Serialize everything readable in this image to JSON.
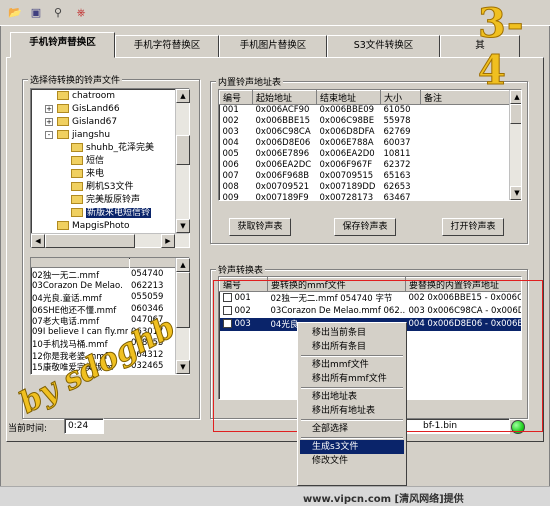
{
  "toolbar": {
    "icons": [
      "open-folder-icon",
      "save-disk-icon",
      "search-tool-icon",
      "exit-icon"
    ]
  },
  "watermark_top": "3-4",
  "tabs": [
    {
      "label": "手机铃声替换区",
      "active": true
    },
    {
      "label": "手机字符替换区",
      "active": false
    },
    {
      "label": "手机图片替换区",
      "active": false
    },
    {
      "label": "S3文件转换区",
      "active": false
    },
    {
      "label": "其",
      "active": false
    }
  ],
  "left": {
    "group_label": "选择待转换的铃声文件",
    "tree": [
      {
        "label": "chatroom",
        "indent": 0,
        "pm": ""
      },
      {
        "label": "GisLand66",
        "indent": 0,
        "pm": "+"
      },
      {
        "label": "Gisland67",
        "indent": 0,
        "pm": "+"
      },
      {
        "label": "jiangshu",
        "indent": 0,
        "pm": "-"
      },
      {
        "label": "shuhb_花泽完美",
        "indent": 1,
        "pm": ""
      },
      {
        "label": "短信",
        "indent": 1,
        "pm": ""
      },
      {
        "label": "来电",
        "indent": 1,
        "pm": ""
      },
      {
        "label": "刷机S3文件",
        "indent": 1,
        "pm": ""
      },
      {
        "label": "完美版原铃声",
        "indent": 1,
        "pm": ""
      },
      {
        "label": "新版来电短信铃",
        "indent": 1,
        "pm": "",
        "selected": true
      },
      {
        "label": "MapgisPhoto",
        "indent": 0,
        "pm": ""
      }
    ],
    "files": [
      [
        "02独一无二.mmf",
        "054740"
      ],
      [
        "03Corazon De Melao.",
        "062213"
      ],
      [
        "04光良.童话.mmf",
        "055059"
      ],
      [
        "06SHE他还不懂.mmf",
        "060346"
      ],
      [
        "07老大电话.mmf",
        "047067"
      ],
      [
        "09I believe I can fly.mmf",
        "063017"
      ],
      [
        "10手机找马桶.mmf",
        "058255"
      ],
      [
        "12你是我老婆.mmf",
        "064312"
      ],
      [
        "15康敬唯爱完美版.m",
        "032465"
      ]
    ]
  },
  "builtin": {
    "group_label": "内置铃声地址表",
    "columns": [
      "编号",
      "起始地址",
      "结束地址",
      "大小",
      "备注"
    ],
    "rows": [
      [
        "001",
        "0x006ACF90",
        "0x006BBE09",
        "61050"
      ],
      [
        "002",
        "0x006BBE15",
        "0x006C98BE",
        "55978"
      ],
      [
        "003",
        "0x006C98CA",
        "0x006D8DFA",
        "62769"
      ],
      [
        "004",
        "0x006D8E06",
        "0x006E788A",
        "60037"
      ],
      [
        "005",
        "0x006E7896",
        "0x006EA2D0",
        "10811"
      ],
      [
        "006",
        "0x006EA2DC",
        "0x006F967F",
        "62372"
      ],
      [
        "007",
        "0x006F968B",
        "0x00709515",
        "65163"
      ],
      [
        "008",
        "0x00709521",
        "0x007189DD",
        "62653"
      ],
      [
        "009",
        "0x007189F9",
        "0x00728173",
        "63467"
      ]
    ],
    "buttons": [
      "获取铃声表",
      "保存铃声表",
      "打开铃声表"
    ]
  },
  "convert": {
    "group_label": "铃声转换表",
    "columns": [
      "编号",
      "要转换的mmf文件",
      "要替换的内置铃声地址"
    ],
    "rows": [
      {
        "id": "001",
        "file": "02独一无二.mmf 054740 字节",
        "addr": "002 0x006BBE15 - 0x006C9",
        "checked": false,
        "selected": false
      },
      {
        "id": "002",
        "file": "03Corazon De Melao.mmf 062...",
        "addr": "003 0x006C98CA - 0x006D8",
        "checked": false,
        "selected": false
      },
      {
        "id": "003",
        "file": "04光良",
        "addr": "004 0x006D8E06 - 0x006E7",
        "checked": true,
        "selected": true
      }
    ]
  },
  "status": {
    "time_label": "当前时间:",
    "time_value": "0:24",
    "file": "bf-1.bin"
  },
  "context_menu": {
    "items": [
      {
        "label": "移出当前条目"
      },
      {
        "label": "移出所有条目"
      },
      {
        "sep": true
      },
      {
        "label": "移出mmf文件"
      },
      {
        "label": "移出所有mmf文件"
      },
      {
        "sep": true
      },
      {
        "label": "移出地址表"
      },
      {
        "label": "移出所有地址表"
      },
      {
        "sep": true
      },
      {
        "label": "全部选择"
      },
      {
        "sep": true
      },
      {
        "label": "生成s3文件",
        "highlight": true
      },
      {
        "label": "修改文件"
      }
    ]
  },
  "watermark_signature": "by sdoghb",
  "footer": "www.vipcn.com [清风网络]提供",
  "colors": {
    "selection": "#0a246a",
    "annotation_red": "#e02020",
    "watermark_yellow": "#f0c020",
    "led_green": "#20d020"
  }
}
